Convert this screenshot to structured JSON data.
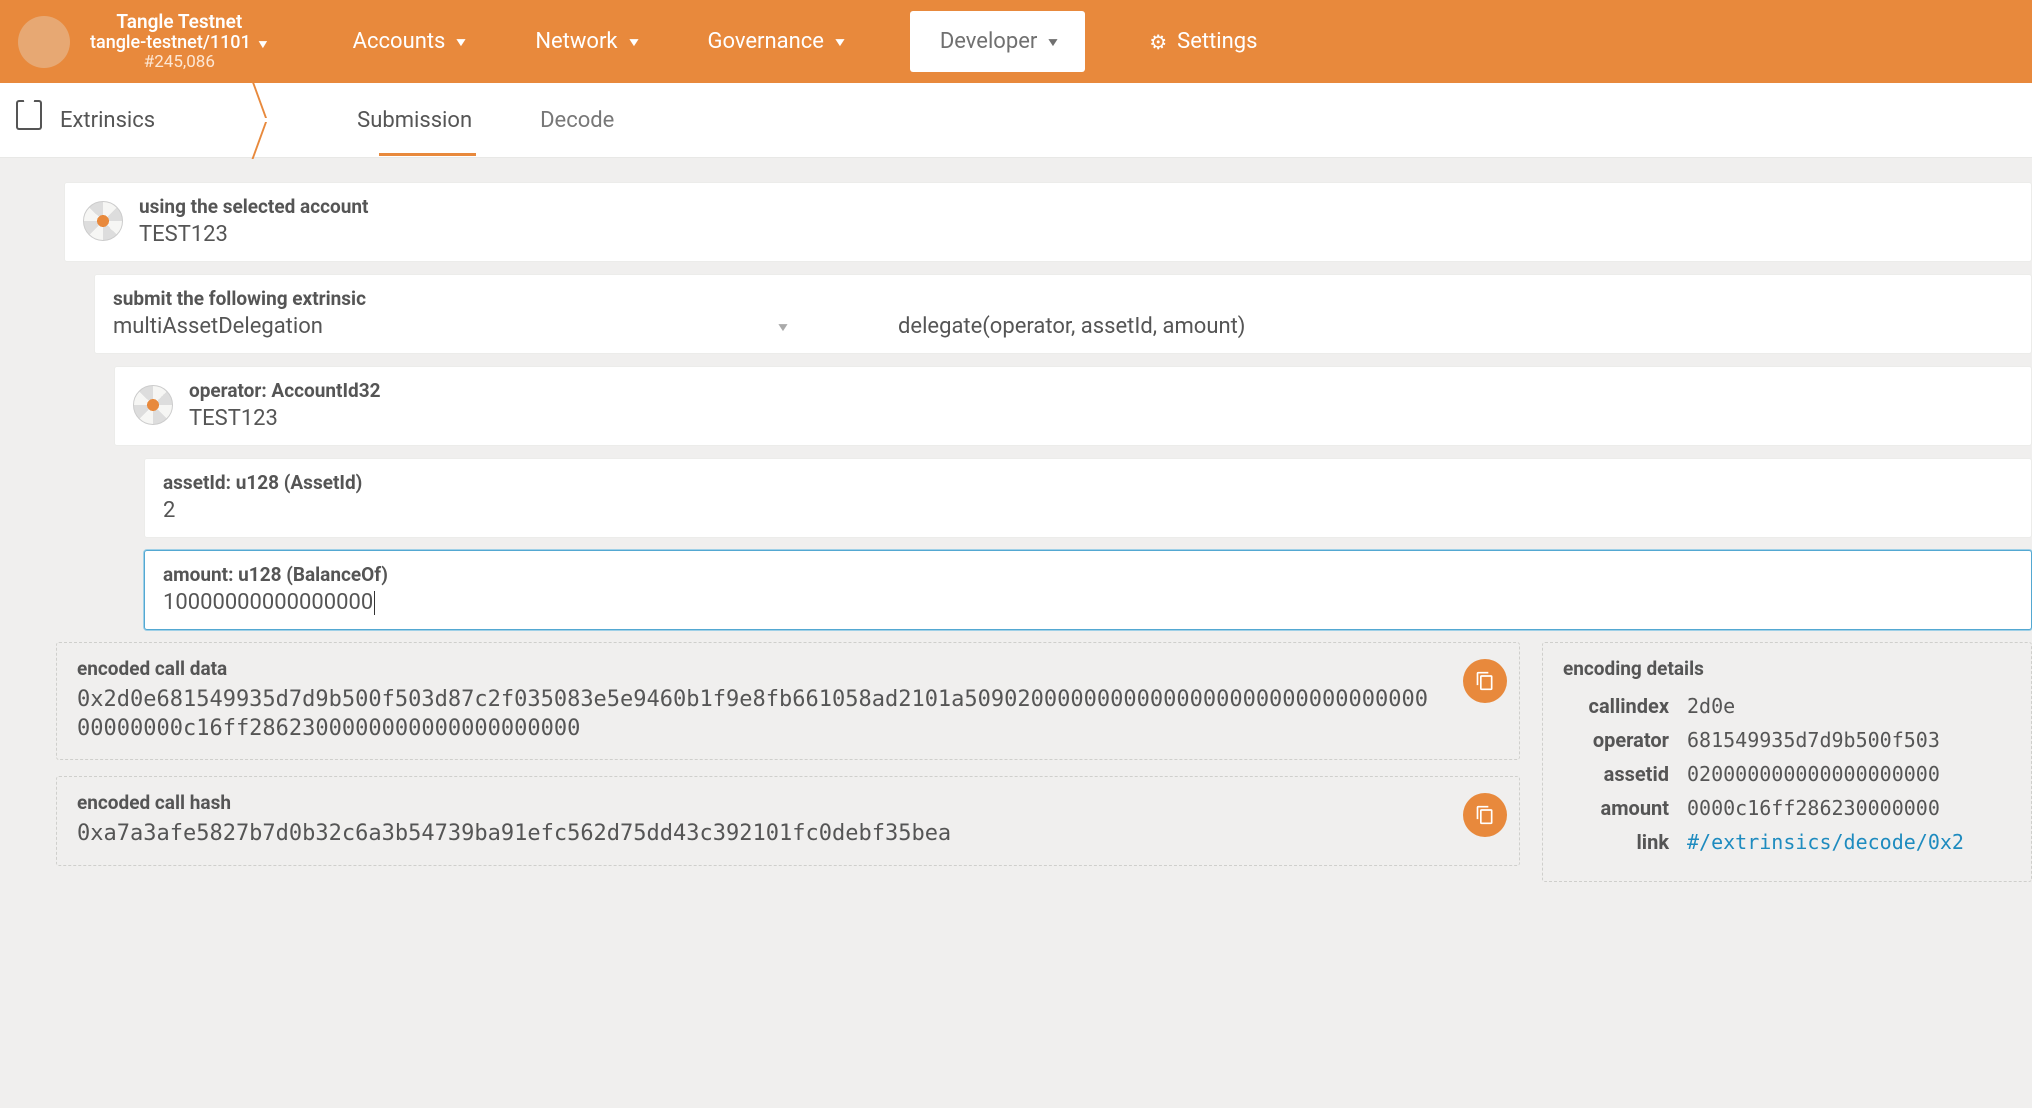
{
  "header": {
    "chain_name": "Tangle Testnet",
    "chain_id": "tangle-testnet/1101",
    "block": "#245,086",
    "menu": {
      "accounts": "Accounts",
      "network": "Network",
      "governance": "Governance",
      "developer": "Developer",
      "settings": "Settings"
    }
  },
  "subbar": {
    "title": "Extrinsics",
    "tabs": {
      "submission": "Submission",
      "decode": "Decode"
    }
  },
  "form": {
    "account_label": "using the selected account",
    "account_value": "TEST123",
    "extrinsic_label": "submit the following extrinsic",
    "pallet": "multiAssetDelegation",
    "call": "delegate(operator, assetId, amount)",
    "operator_label": "operator: AccountId32",
    "operator_value": "TEST123",
    "assetid_label": "assetId: u128 (AssetId)",
    "assetid_value": "2",
    "amount_label": "amount: u128 (BalanceOf)",
    "amount_value": "10000000000000000"
  },
  "encoded": {
    "calldata_label": "encoded call data",
    "calldata": "0x2d0e681549935d7d9b500f503d87c2f035083e5e9460b1f9e8fb661058ad2101a5090200000000000000000000000000000000000000c16ff2862300000000000000000000",
    "callhash_label": "encoded call hash",
    "callhash": "0xa7a3afe5827b7d0b32c6a3b54739ba91efc562d75dd43c392101fc0debf35bea"
  },
  "details": {
    "label": "encoding details",
    "rows": {
      "callindex_k": "callindex",
      "callindex_v": "2d0e",
      "operator_k": "operator",
      "operator_v": "681549935d7d9b500f503",
      "assetid_k": "assetid",
      "assetid_v": "020000000000000000000",
      "amount_k": "amount",
      "amount_v": "0000c16ff286230000000",
      "link_k": "link",
      "link_v": "#/extrinsics/decode/0x2"
    }
  }
}
